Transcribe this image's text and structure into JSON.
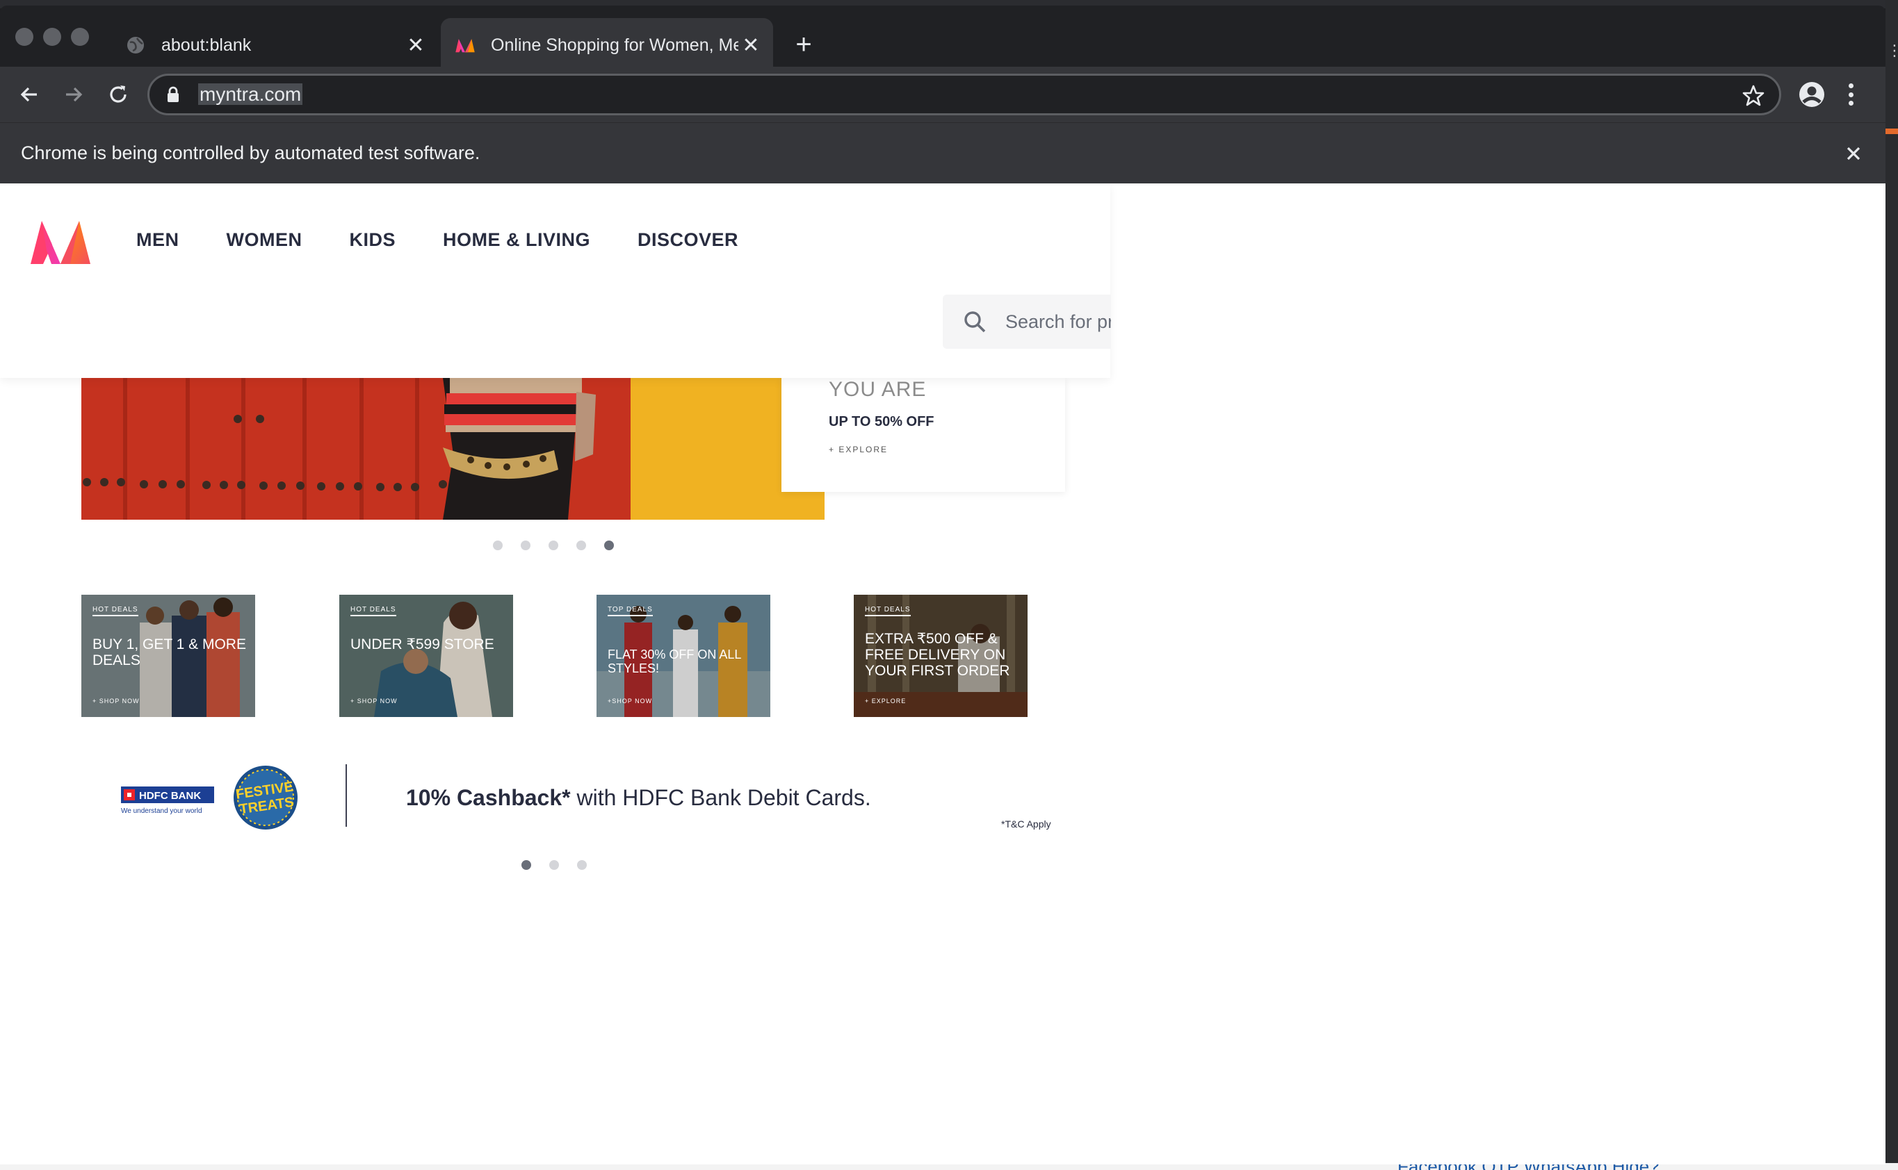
{
  "background_windows": {
    "bottom_text": "Facebook OTP WhatsApp Hide?"
  },
  "tabs": [
    {
      "title": "about:blank",
      "favicon": "globe-icon",
      "active": false
    },
    {
      "title": "Online Shopping for Women, Men",
      "favicon": "myntra-logo-icon",
      "active": true
    }
  ],
  "omnibox": {
    "url": "myntra.com"
  },
  "infobar": {
    "message": "Chrome is being controlled by automated test software."
  },
  "site": {
    "nav": [
      "MEN",
      "WOMEN",
      "KIDS",
      "HOME & LIVING",
      "DISCOVER"
    ],
    "search_placeholder": "Search for products, brands and more"
  },
  "hero": {
    "headline": "YOU ARE",
    "offer": "UP TO 50% OFF",
    "cta": "+ EXPLORE",
    "slides": 5,
    "active_slide": 5
  },
  "deals": [
    {
      "tag": "HOT DEALS",
      "title": "BUY 1, GET 1 & MORE DEALS",
      "cta": "+ SHOP NOW"
    },
    {
      "tag": "HOT DEALS",
      "title": "UNDER ₹599 STORE",
      "cta": "+ SHOP NOW"
    },
    {
      "tag": "TOP DEALS",
      "title": "FLAT 30% OFF ON ALL STYLES!",
      "cta": "+SHOP NOW"
    },
    {
      "tag": "HOT DEALS",
      "title": "EXTRA ₹500 OFF & FREE DELIVERY ON YOUR FIRST ORDER",
      "cta": "+ EXPLORE"
    }
  ],
  "bank_offer": {
    "bank_name": "HDFC BANK",
    "bank_tagline": "We understand your world",
    "badge": "FESTIVE TREATS",
    "cashback_bold": "10% Cashback*",
    "cashback_rest": " with HDFC Bank Debit Cards.",
    "tc": "*T&C Apply",
    "slides": 3,
    "active_slide": 1
  },
  "colors": {
    "chrome_dark": "#202124",
    "chrome_toolbar": "#35363a",
    "myntra_text": "#282c3f",
    "myntra_pink": "#ff3f6c",
    "myntra_orange": "#f13ab1"
  }
}
